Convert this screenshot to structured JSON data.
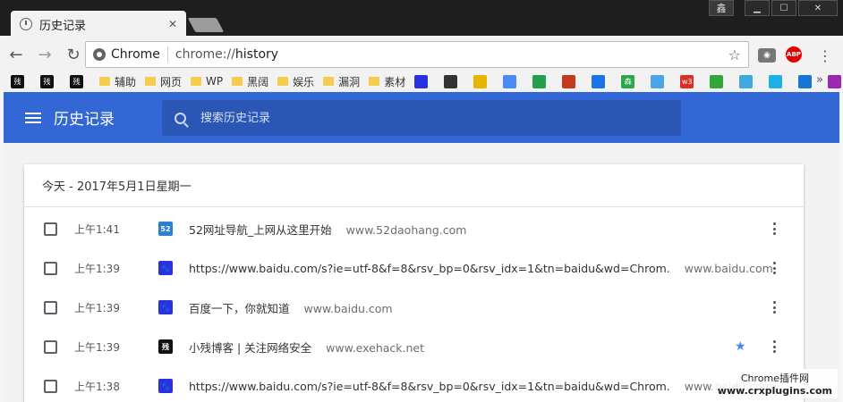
{
  "browser": {
    "tab_title": "历史记录",
    "tab_close": "✕",
    "window_buttons": {
      "user": "鑫",
      "minimize": "▁",
      "maximize": "☐",
      "close": "✕"
    },
    "nav": {
      "back": "←",
      "forward": "→",
      "reload": "↻"
    },
    "omnibox": {
      "label": "Chrome",
      "url_scheme": "chrome://",
      "url_host": "history"
    },
    "extensions": {
      "abp": "ABP",
      "menu": "⋮"
    },
    "bookmarks": [
      {
        "label": "",
        "icon": "exehack-icon",
        "color": "#111111",
        "glyph": "残"
      },
      {
        "label": "",
        "icon": "exehack-icon",
        "color": "#111111",
        "glyph": "残"
      },
      {
        "label": "",
        "icon": "exehack-icon",
        "color": "#111111",
        "glyph": "残"
      },
      {
        "label": "辅助",
        "icon": "folder-icon"
      },
      {
        "label": "网页",
        "icon": "folder-icon"
      },
      {
        "label": "WP",
        "icon": "folder-icon"
      },
      {
        "label": "黑阔",
        "icon": "folder-icon"
      },
      {
        "label": "娱乐",
        "icon": "folder-icon"
      },
      {
        "label": "漏洞",
        "icon": "folder-icon"
      },
      {
        "label": "素材",
        "icon": "folder-icon"
      }
    ],
    "bookmark_icons": [
      {
        "icon": "baidu-paw-icon",
        "color": "#2932e1"
      },
      {
        "icon": "brackets-icon",
        "color": "#333333"
      },
      {
        "icon": "yellow-square-icon",
        "color": "#e8b400"
      },
      {
        "icon": "translate-icon",
        "color": "#4a8af4"
      },
      {
        "icon": "green-cube-icon",
        "color": "#23a04a"
      },
      {
        "icon": "mascot-icon",
        "color": "#c33a1c"
      },
      {
        "icon": "s-icon",
        "color": "#1a73e8"
      },
      {
        "icon": "sen-icon",
        "color": "#2aa84a",
        "glyph": "森"
      },
      {
        "icon": "cloud-icon",
        "color": "#4aa5e8"
      },
      {
        "icon": "w3-icon",
        "color": "#d93025",
        "glyph": "w3"
      },
      {
        "icon": "play-icon",
        "color": "#31a639"
      },
      {
        "icon": "diamond-icon",
        "color": "#3fa9dc"
      },
      {
        "icon": "globe-icon",
        "color": "#1db0e6"
      },
      {
        "icon": "b-icon",
        "color": "#1677d2"
      },
      {
        "icon": "color-wheel-icon",
        "color": "#9c27b0"
      }
    ],
    "bookmarks_more": "»"
  },
  "header": {
    "title": "历史记录",
    "search_placeholder": "搜索历史记录",
    "accent": "#3367d6"
  },
  "history": {
    "date_heading": "今天 - 2017年5月1日星期一",
    "items": [
      {
        "time": "上午1:41",
        "favicon": "52-icon",
        "favicon_text": "52",
        "title": "52网址导航_上网从这里开始",
        "domain": "www.52daohang.com",
        "starred": false
      },
      {
        "time": "上午1:39",
        "favicon": "baidu-paw-icon",
        "favicon_text": "🐾",
        "title": "https://www.baidu.com/s?ie=utf-8&f=8&rsv_bp=0&rsv_idx=1&tn=baidu&wd=Chrom.",
        "domain": "www.baidu.com",
        "starred": false
      },
      {
        "time": "上午1:39",
        "favicon": "baidu-paw-icon",
        "favicon_text": "🐾",
        "title": "百度一下，你就知道",
        "domain": "www.baidu.com",
        "starred": false
      },
      {
        "time": "上午1:39",
        "favicon": "exehack-icon",
        "favicon_text": "残",
        "title": "小残博客 | 关注网络安全",
        "domain": "www.exehack.net",
        "starred": true
      },
      {
        "time": "上午1:38",
        "favicon": "baidu-paw-icon",
        "favicon_text": "🐾",
        "title": "https://www.baidu.com/s?ie=utf-8&f=8&rsv_bp=0&rsv_idx=1&tn=baidu&wd=Chrom.",
        "domain": "www.baidu.com",
        "starred": false
      }
    ]
  },
  "watermark": {
    "line1": "Chrome插件网",
    "line2": "www.crxplugins.com"
  }
}
